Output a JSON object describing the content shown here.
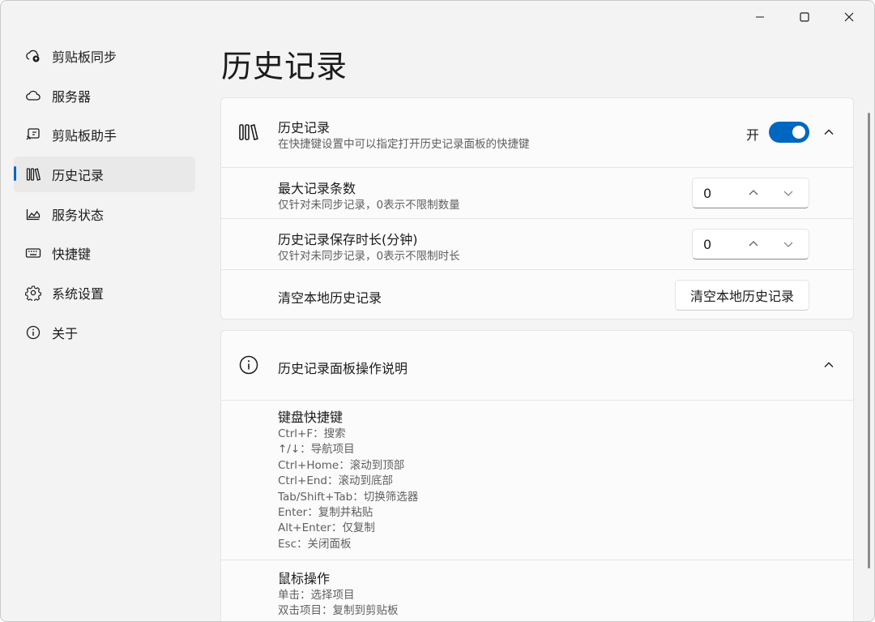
{
  "window": {
    "controls": {
      "minimize_icon": "minimize-icon",
      "maximize_icon": "maximize-icon",
      "close_icon": "close-icon"
    }
  },
  "sidebar": {
    "items": [
      {
        "label": "剪贴板同步",
        "icon": "cloud-sync-icon"
      },
      {
        "label": "服务器",
        "icon": "cloud-icon"
      },
      {
        "label": "剪贴板助手",
        "icon": "clipboard-assistant-icon"
      },
      {
        "label": "历史记录",
        "icon": "library-icon",
        "active": true
      },
      {
        "label": "服务状态",
        "icon": "area-chart-icon"
      },
      {
        "label": "快捷键",
        "icon": "keyboard-icon"
      },
      {
        "label": "系统设置",
        "icon": "gear-icon"
      },
      {
        "label": "关于",
        "icon": "info-icon"
      }
    ]
  },
  "page": {
    "title": "历史记录"
  },
  "history_card": {
    "header": {
      "title": "历史记录",
      "description": "在快捷键设置中可以指定打开历史记录面板的快捷键",
      "toggle_label": "开",
      "toggle_on": true
    },
    "max_count": {
      "title": "最大记录条数",
      "description": "仅针对未同步记录，0表示不限制数量",
      "value": "0"
    },
    "retention": {
      "title": "历史记录保存时长(分钟)",
      "description": "仅针对未同步记录，0表示不限制时长",
      "value": "0"
    },
    "clear": {
      "title": "清空本地历史记录",
      "button_label": "清空本地历史记录"
    }
  },
  "help_card": {
    "title": "历史记录面板操作说明",
    "keyboard": {
      "title": "键盘快捷键",
      "lines": [
        "Ctrl+F：搜索",
        "↑/↓：导航项目",
        "Ctrl+Home：滚动到顶部",
        "Ctrl+End：滚动到底部",
        "Tab/Shift+Tab：切换筛选器",
        "Enter：复制并粘贴",
        "Alt+Enter：仅复制",
        "Esc：关闭面板"
      ]
    },
    "mouse": {
      "title": "鼠标操作",
      "lines": [
        "单击：选择项目",
        "双击项目：复制到剪贴板"
      ]
    }
  },
  "colors": {
    "accent": "#0067c0",
    "background": "#f3f3f3",
    "card": "#fbfbfb"
  }
}
